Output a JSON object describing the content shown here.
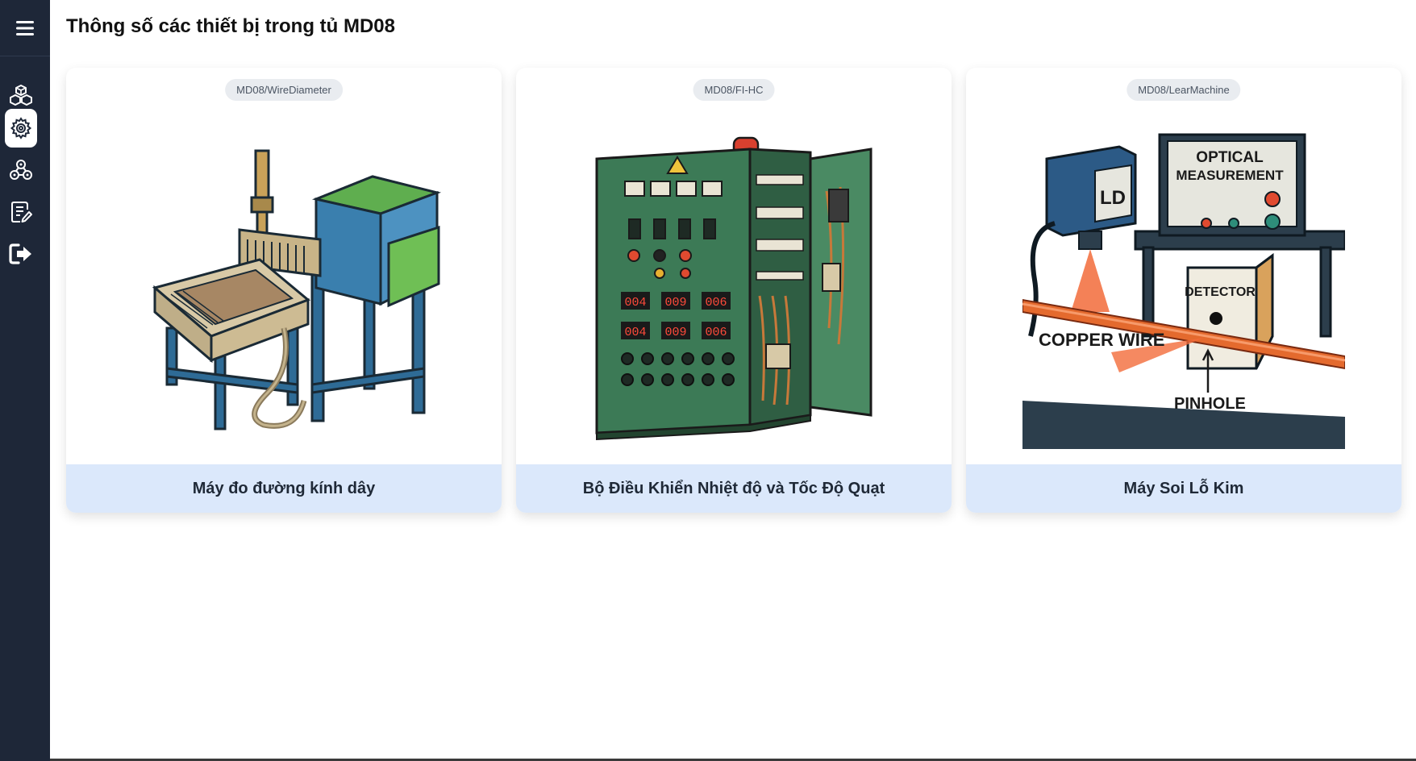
{
  "page": {
    "title": "Thông số các thiết bị trong tủ MD08"
  },
  "sidebar": {
    "menu_icon": "hamburger-icon",
    "items": [
      {
        "icon": "boxes-icon",
        "active": false
      },
      {
        "icon": "gear-icon",
        "active": true
      },
      {
        "icon": "network-icon",
        "active": false
      },
      {
        "icon": "edit-document-icon",
        "active": false
      },
      {
        "icon": "logout-icon",
        "active": false
      }
    ]
  },
  "cards": [
    {
      "tag": "MD08/WireDiameter",
      "title": "Máy đo đường kính dây",
      "illustration": "wire-diameter-machine"
    },
    {
      "tag": "MD08/FI-HC",
      "title": "Bộ Điều Khiển Nhiệt độ và Tốc Độ Quạt",
      "illustration": "control-cabinet",
      "display_readouts": [
        "004",
        "009",
        "006",
        "004",
        "009",
        "006"
      ]
    },
    {
      "tag": "MD08/LearMachine",
      "title": "Máy Soi Lỗ Kim",
      "illustration": "pinhole-detector",
      "labels": {
        "ld": "LD",
        "optical": "OPTICAL",
        "measurement": "MEASUREMENT",
        "detector": "DETECTOR",
        "copper_wire": "COPPER WIRE",
        "pinhole": "PINHOLE"
      }
    }
  ],
  "colors": {
    "sidebar_bg": "#1e2738",
    "card_footer_bg": "#dbe8fb",
    "machine_green": "#5cb85c",
    "cabinet_green": "#3c7a56",
    "wire_copper": "#e46a2e"
  }
}
